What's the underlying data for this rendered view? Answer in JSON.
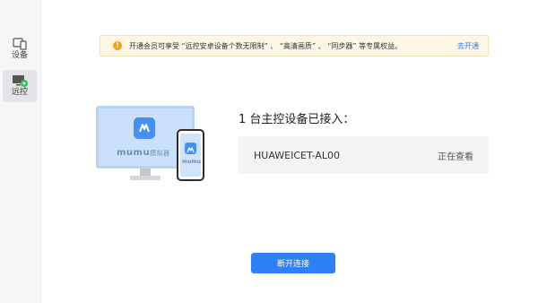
{
  "sidebar": {
    "items": [
      {
        "label": "设备",
        "icon": "devices-icon",
        "active": false
      },
      {
        "label": "远控",
        "icon": "remote-control-icon",
        "active": true
      }
    ]
  },
  "notice": {
    "text": "开通会员可享受 “远控安卓设备个数无限制” 、 “高清画质” 、 “同步器” 等专属权益。",
    "link": "去开通",
    "icon": "warning-icon"
  },
  "illustration": {
    "brand": "mumu",
    "brand_suffix": "模拟器",
    "phone_brand": "mumu"
  },
  "devices": {
    "title": "1 台主控设备已接入：",
    "list": [
      {
        "name": "HUAWEICET-AL00",
        "status": "正在查看"
      }
    ]
  },
  "actions": {
    "disconnect_label": "断开连接"
  },
  "colors": {
    "accent": "#2f80f6",
    "notice_bg": "#fdf6e4",
    "notice_icon": "#f2a20c"
  }
}
